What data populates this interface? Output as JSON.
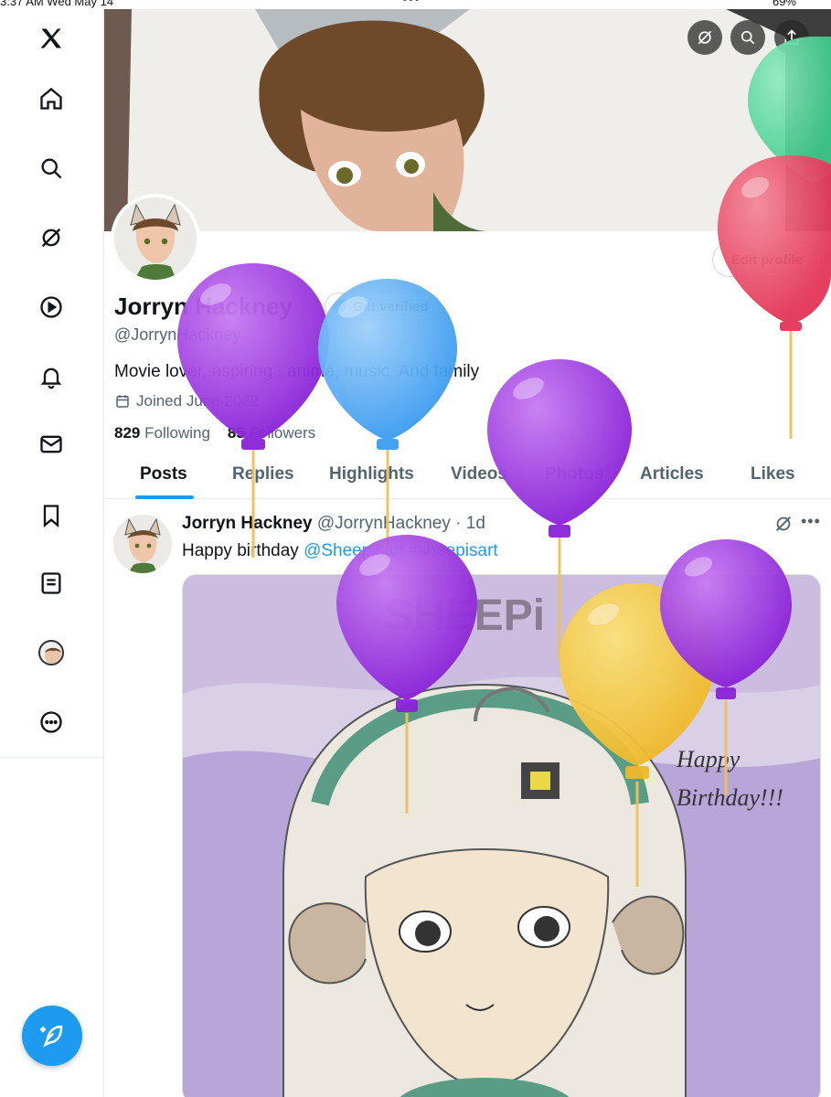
{
  "status_bar": {
    "time": "3:37 AM  Wed May 14",
    "dots": "•••",
    "battery": "69%"
  },
  "nav": {
    "items": [
      {
        "name": "x-logo-icon"
      },
      {
        "name": "home-icon"
      },
      {
        "name": "search-icon"
      },
      {
        "name": "grok-icon"
      },
      {
        "name": "video-icon"
      },
      {
        "name": "notifications-icon"
      },
      {
        "name": "messages-icon"
      },
      {
        "name": "bookmarks-icon"
      },
      {
        "name": "lists-icon"
      },
      {
        "name": "profile-avatar-icon"
      },
      {
        "name": "more-icon"
      }
    ],
    "compose_icon": "compose-post-icon"
  },
  "profile": {
    "name": "Jorryn Hackney",
    "handle": "@JorrynHackney",
    "verify_label": "Get verified",
    "edit_label": "Edit profile",
    "bio": "Movie lover, aspiring , anime, music, And family",
    "joined": "Joined June 2022",
    "following_count": "829",
    "following_label": "Following",
    "followers_count": "85",
    "followers_label": "Followers"
  },
  "tabs": [
    "Posts",
    "Replies",
    "Highlights",
    "Videos",
    "Photos",
    "Articles",
    "Likes"
  ],
  "active_tab": "Posts",
  "post": {
    "author": "Jorryn Hackney",
    "handle": "@JorrynHackney",
    "separator": "·",
    "time": "1d",
    "text": "Happy birthday ",
    "mention": "@Sheepisan",
    "hashtag": "#sheepisart",
    "media_text_top": "SHEEPi",
    "media_text_1": "Happy",
    "media_text_2": "Birthday!!!"
  },
  "colors": {
    "accent": "#1d9bf0",
    "text_primary": "#0f1419",
    "text_secondary": "#536471",
    "balloon_purple": "#9b30e0",
    "balloon_blue": "#4aa8f5",
    "balloon_yellow": "#f5c63a",
    "balloon_red": "#e8435f",
    "balloon_green": "#4fd69a"
  }
}
